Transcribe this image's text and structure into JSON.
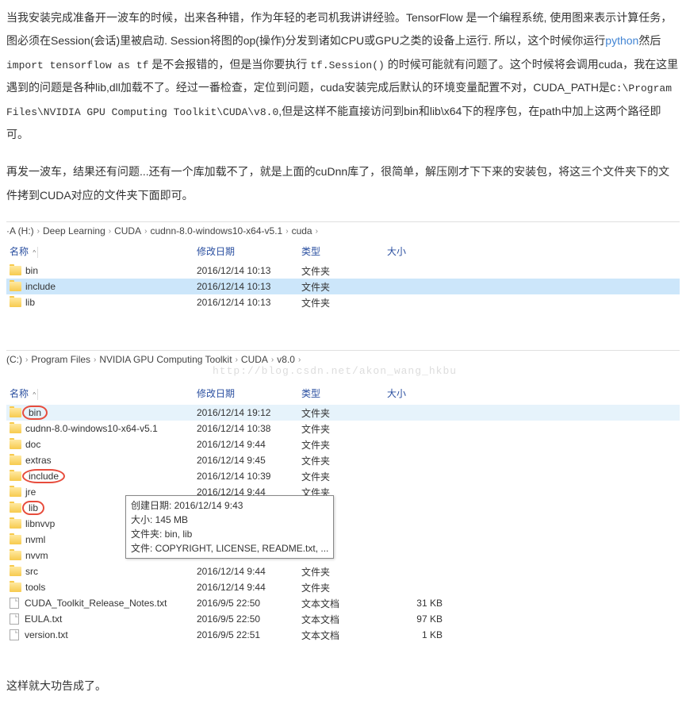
{
  "para1_parts": {
    "t1": "当我安装完成准备开一波车的时候，出来各种错，作为年轻的老司机我讲讲经验。TensorFlow 是一个编程系统, 使用图来表示计算任务，图必须在Session(会话)里被启动. Session将图的op(操作)分发到诸如CPU或GPU之类的设备上运行.  所以，这个时候你运行",
    "t2": "python",
    "t3": "然后 ",
    "t4": "import tensorflow as tf",
    "t5": " 是不会报错的，但是当你要执行 ",
    "t6": "tf.Session()",
    "t7": " 的时候可能就有问题了。这个时候将会调用cuda，我在这里遇到的问题是各种lib,dll加载不了。经过一番检查，定位到问题，cuda安装完成后默认的环境变量配置不对，CUDA_PATH是",
    "t8": "C:\\Program Files\\NVIDIA GPU Computing Toolkit\\CUDA\\v8.0",
    "t9": ",但是这样不能直接访问到bin和lib\\x64下的程序包，在path中加上这两个路径即可。"
  },
  "para2": "再发一波车，结果还有问题...还有一个库加载不了，就是上面的cuDnn库了，很简单，解压刚才下下来的安装包，将这三个文件夹下的文件拷到CUDA对应的文件夹下面即可。",
  "para3": "这样就大功告成了。",
  "explorer1": {
    "drive": "·A (H:)",
    "crumbs": [
      "Deep Learning",
      "CUDA",
      "cudnn-8.0-windows10-x64-v5.1",
      "cuda"
    ],
    "cols": {
      "name": "名称",
      "date": "修改日期",
      "type": "类型",
      "size": "大小"
    },
    "rows": [
      {
        "name": "bin",
        "date": "2016/12/14 10:13",
        "type": "文件夹",
        "size": "",
        "icon": "folder"
      },
      {
        "name": "include",
        "date": "2016/12/14 10:13",
        "type": "文件夹",
        "size": "",
        "icon": "folder",
        "selected": true
      },
      {
        "name": "lib",
        "date": "2016/12/14 10:13",
        "type": "文件夹",
        "size": "",
        "icon": "folder"
      }
    ]
  },
  "explorer2": {
    "drive": "(C:)",
    "crumbs": [
      "Program Files",
      "NVIDIA GPU Computing Toolkit",
      "CUDA",
      "v8.0"
    ],
    "cols": {
      "name": "名称",
      "date": "修改日期",
      "type": "类型",
      "size": "大小"
    },
    "rows": [
      {
        "name": "bin",
        "date": "2016/12/14 19:12",
        "type": "文件夹",
        "size": "",
        "icon": "folder",
        "circled": true,
        "hover": true
      },
      {
        "name": "cudnn-8.0-windows10-x64-v5.1",
        "date": "2016/12/14 10:38",
        "type": "文件夹",
        "size": "",
        "icon": "folder"
      },
      {
        "name": "doc",
        "date": "2016/12/14 9:44",
        "type": "文件夹",
        "size": "",
        "icon": "folder"
      },
      {
        "name": "extras",
        "date": "2016/12/14 9:45",
        "type": "文件夹",
        "size": "",
        "icon": "folder"
      },
      {
        "name": "include",
        "date": "2016/12/14 10:39",
        "type": "文件夹",
        "size": "",
        "icon": "folder",
        "circled": true
      },
      {
        "name": "jre",
        "date": "2016/12/14 9:44",
        "type": "文件夹",
        "size": "",
        "icon": "folder"
      },
      {
        "name": "lib",
        "date": "",
        "type": "",
        "size": "",
        "icon": "folder",
        "circled": true,
        "tooltip": true
      },
      {
        "name": "libnvvp",
        "date": "",
        "type": "",
        "size": "",
        "icon": "folder"
      },
      {
        "name": "nvml",
        "date": "",
        "type": "",
        "size": "",
        "icon": "folder"
      },
      {
        "name": "nvvm",
        "date": "",
        "type": "",
        "size": "",
        "icon": "folder"
      },
      {
        "name": "src",
        "date": "2016/12/14 9:44",
        "type": "文件夹",
        "size": "",
        "icon": "folder"
      },
      {
        "name": "tools",
        "date": "2016/12/14 9:44",
        "type": "文件夹",
        "size": "",
        "icon": "folder"
      },
      {
        "name": "CUDA_Toolkit_Release_Notes.txt",
        "date": "2016/9/5 22:50",
        "type": "文本文档",
        "size": "31 KB",
        "icon": "file"
      },
      {
        "name": "EULA.txt",
        "date": "2016/9/5 22:50",
        "type": "文本文档",
        "size": "97 KB",
        "icon": "file"
      },
      {
        "name": "version.txt",
        "date": "2016/9/5 22:51",
        "type": "文本文档",
        "size": "1 KB",
        "icon": "file"
      }
    ]
  },
  "tooltip": {
    "l1": "创建日期: 2016/12/14 9:43",
    "l2": "大小: 145 MB",
    "l3": "文件夹: bin, lib",
    "l4": "文件: COPYRIGHT, LICENSE, README.txt, ..."
  },
  "watermark": "http://blog.csdn.net/akon_wang_hkbu"
}
